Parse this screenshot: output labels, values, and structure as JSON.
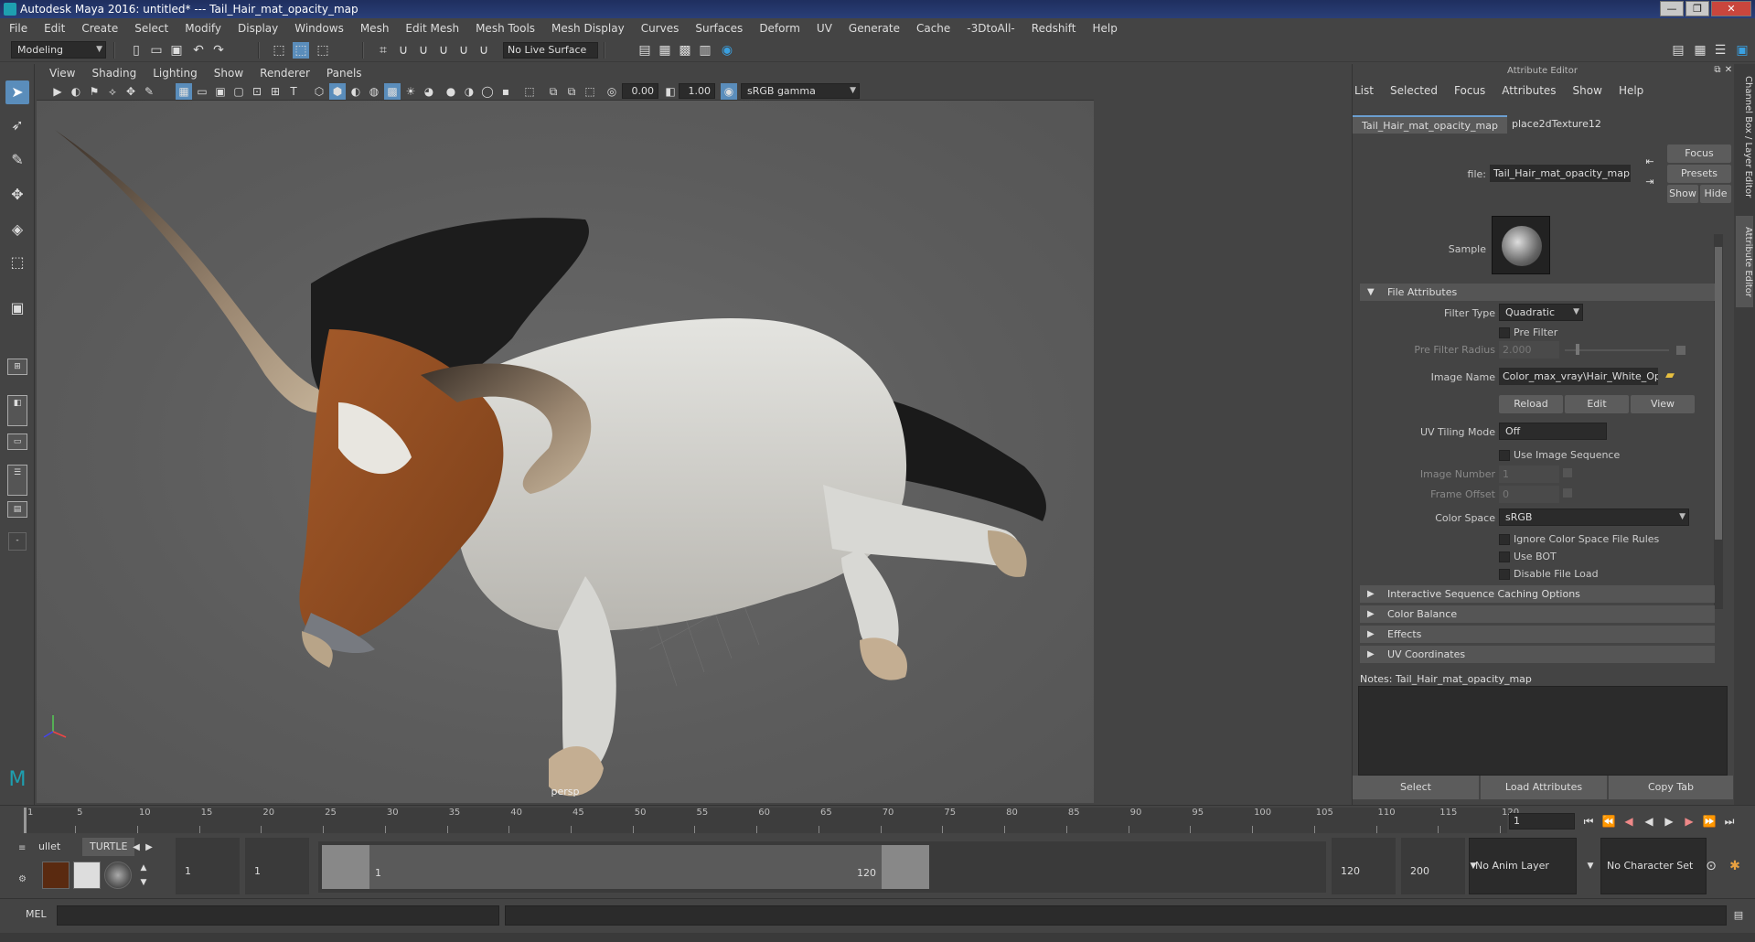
{
  "window": {
    "title": "Autodesk Maya 2016: untitled*   ---   Tail_Hair_mat_opacity_map",
    "controls": [
      "—",
      "❐",
      "✕"
    ]
  },
  "menubar": [
    "File",
    "Edit",
    "Create",
    "Select",
    "Modify",
    "Display",
    "Windows",
    "Mesh",
    "Edit Mesh",
    "Mesh Tools",
    "Mesh Display",
    "Curves",
    "Surfaces",
    "Deform",
    "UV",
    "Generate",
    "Cache",
    "-3DtoAll-",
    "Redshift",
    "Help"
  ],
  "statusline": {
    "menuset": "Modeling",
    "live_surface": "No Live Surface"
  },
  "viewport": {
    "menu": [
      "View",
      "Shading",
      "Lighting",
      "Show",
      "Renderer",
      "Panels"
    ],
    "exposure": "0.00",
    "gamma": "1.00",
    "color_space": "sRGB gamma",
    "camera_label": "persp"
  },
  "attribute_editor": {
    "title": "Attribute Editor",
    "menu": [
      "List",
      "Selected",
      "Focus",
      "Attributes",
      "Show",
      "Help"
    ],
    "tabs": [
      "Tail_Hair_mat_opacity_map",
      "place2dTexture12"
    ],
    "side_buttons": {
      "focus": "Focus",
      "presets": "Presets",
      "show": "Show",
      "hide": "Hide"
    },
    "file_label": "file:",
    "file_value": "Tail_Hair_mat_opacity_map",
    "sample_label": "Sample",
    "sections": {
      "file_attributes": "File Attributes",
      "interactive": "Interactive Sequence Caching Options",
      "color_balance": "Color Balance",
      "effects": "Effects",
      "uv_coordinates": "UV Coordinates"
    },
    "filter_type_label": "Filter Type",
    "filter_type_value": "Quadratic",
    "pre_filter": "Pre Filter",
    "pre_filter_radius_label": "Pre Filter Radius",
    "pre_filter_radius_value": "2.000",
    "image_name_label": "Image Name",
    "image_name_value": "Color_max_vray\\Hair_White_Opacity.png",
    "reload": "Reload",
    "edit": "Edit",
    "view": "View",
    "uv_tiling_label": "UV Tiling Mode",
    "uv_tiling_value": "Off",
    "use_image_sequence": "Use Image Sequence",
    "image_number_label": "Image Number",
    "image_number_value": "1",
    "frame_offset_label": "Frame Offset",
    "frame_offset_value": "0",
    "color_space_label": "Color Space",
    "color_space_value": "sRGB",
    "ignore_cs_rules": "Ignore Color Space File Rules",
    "use_bot": "Use BOT",
    "disable_file_load": "Disable File Load",
    "notes_label": "Notes:  Tail_Hair_mat_opacity_map",
    "bottom_buttons": {
      "select": "Select",
      "load": "Load Attributes",
      "copy": "Copy Tab"
    }
  },
  "side_tabs": {
    "channel_box": "Channel Box / Layer Editor",
    "attribute_editor": "Attribute Editor"
  },
  "timeline": {
    "ticks": [
      "1",
      "5",
      "10",
      "15",
      "20",
      "25",
      "30",
      "35",
      "40",
      "45",
      "50",
      "55",
      "60",
      "65",
      "70",
      "75",
      "80",
      "85",
      "90",
      "95",
      "100",
      "105",
      "110",
      "115",
      "120"
    ],
    "current_frame": "1"
  },
  "range": {
    "shelf_tabs": [
      "ullet",
      "TURTLE"
    ],
    "start": "1",
    "playback_start": "1",
    "handle_start": "1",
    "handle_end": "120",
    "playback_end": "120",
    "end": "200",
    "anim_layer": "No Anim Layer",
    "character_set": "No Character Set"
  },
  "cmdline": {
    "label": "MEL"
  }
}
